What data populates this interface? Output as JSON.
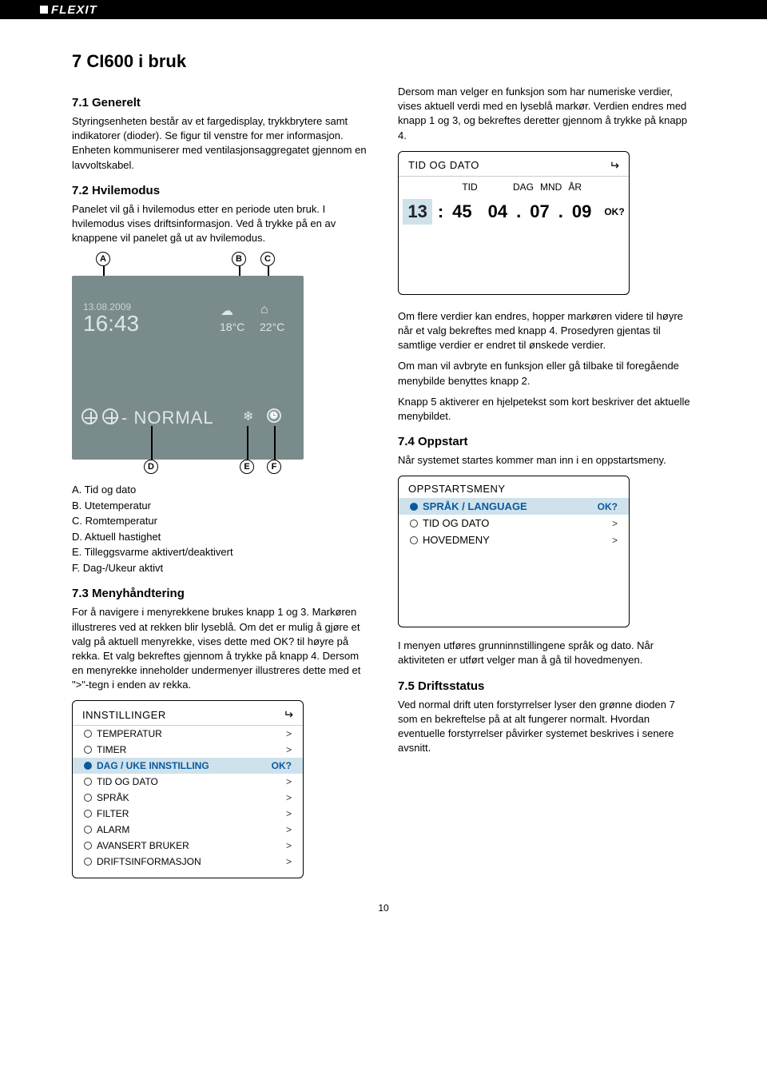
{
  "brand": "FLEXIT",
  "page_number": "10",
  "h1": "7   CI600 i bruk",
  "s71": {
    "heading": "7.1   Generelt",
    "p1": "Styringsenheten består av et fargedisplay, trykkbrytere samt indikatorer (dioder). Se figur til venstre for mer informasjon. Enheten kommuniserer med ventilasjonsaggregatet gjennom en lavvoltskabel."
  },
  "s72": {
    "heading": "7.2   Hvilemodus",
    "p1": "Panelet vil gå i hvilemodus etter en periode uten bruk. I hvilemodus vises driftsinformasjon. Ved å trykke på en av knappene vil panelet gå ut av hvilemodus."
  },
  "display": {
    "date": "13.08.2009",
    "time": "16:43",
    "outtemp": "18°C",
    "roomtemp": "22°C",
    "mode": "- NORMAL"
  },
  "callouts": {
    "A": "A",
    "B": "B",
    "C": "C",
    "D": "D",
    "E": "E",
    "F": "F"
  },
  "legend": {
    "A": "A. Tid og dato",
    "B": "B. Utetemperatur",
    "C": "C. Romtemperatur",
    "D": "D. Aktuell hastighet",
    "E": "E. Tilleggsvarme aktivert/deaktivert",
    "F": "F. Dag-/Ukeur aktivt"
  },
  "s73": {
    "heading": "7.3   Menyhåndtering",
    "p1": "For å navigere i menyrekkene brukes knapp 1 og 3. Markøren illustreres ved at rekken blir lyseblå. Om det er mulig å gjøre et valg på aktuell menyrekke, vises dette med OK? til høyre på rekka. Et valg bekreftes gjennom å trykke på knapp 4. Dersom en menyrekke inneholder undermenyer illustreres dette med et \">\"-tegn i enden av rekka."
  },
  "innst": {
    "title": "INNSTILLINGER",
    "rows": [
      {
        "label": "TEMPERATUR",
        "arr": ">"
      },
      {
        "label": "TIMER",
        "arr": ">"
      },
      {
        "label": "DAG / UKE INNSTILLING",
        "arr": "OK?",
        "sel": true
      },
      {
        "label": "TID OG DATO",
        "arr": ">"
      },
      {
        "label": "SPRÅK",
        "arr": ">"
      },
      {
        "label": "FILTER",
        "arr": ">"
      },
      {
        "label": "ALARM",
        "arr": ">"
      },
      {
        "label": "AVANSERT BRUKER",
        "arr": ">"
      },
      {
        "label": "DRIFTSINFORMASJON",
        "arr": ">"
      }
    ]
  },
  "right_intro": "Dersom man velger en funksjon som har numeriske verdier, vises aktuell verdi med en lyseblå markør. Verdien endres med knapp 1 og 3, og bekreftes deretter gjennom å trykke på knapp 4.",
  "tid": {
    "title": "TID OG DATO",
    "h_tid": "TID",
    "h_dag": "DAG",
    "h_mnd": "MND",
    "h_ar": "ÅR",
    "hh": "13",
    "mm": "45",
    "dd": "04",
    "mo": "07",
    "yy": "09",
    "ok": "OK?"
  },
  "right_p2": "Om flere verdier kan endres, hopper markøren videre til høyre når et valg bekreftes med knapp 4. Prosedyren gjentas til samtlige verdier er endret til ønskede verdier.",
  "right_p3": "Om man vil avbryte en funksjon eller gå tilbake til foregående menybilde benyttes knapp 2.",
  "right_p4": "Knapp 5 aktiverer en hjelpetekst som kort beskriver det aktuelle menybildet.",
  "s74": {
    "heading": "7.4   Oppstart",
    "p1": "Når systemet startes kommer man inn i en oppstartsmeny."
  },
  "opp": {
    "title": "OPPSTARTSMENY",
    "rows": [
      {
        "label": "SPRÅK / LANGUAGE",
        "arr": "OK?",
        "sel": true
      },
      {
        "label": "TID OG DATO",
        "arr": ">"
      },
      {
        "label": "HOVEDMENY",
        "arr": ">"
      }
    ]
  },
  "opp_after": "I menyen utføres grunninnstillingene språk og dato. Når aktiviteten er utført velger man å gå til hovedmenyen.",
  "s75": {
    "heading": "7.5   Driftsstatus",
    "p1": "Ved normal drift uten forstyrrelser lyser den grønne dioden 7 som en bekreftelse på at alt fungerer normalt. Hvordan eventuelle forstyrrelser påvirker systemet beskrives i senere avsnitt."
  }
}
